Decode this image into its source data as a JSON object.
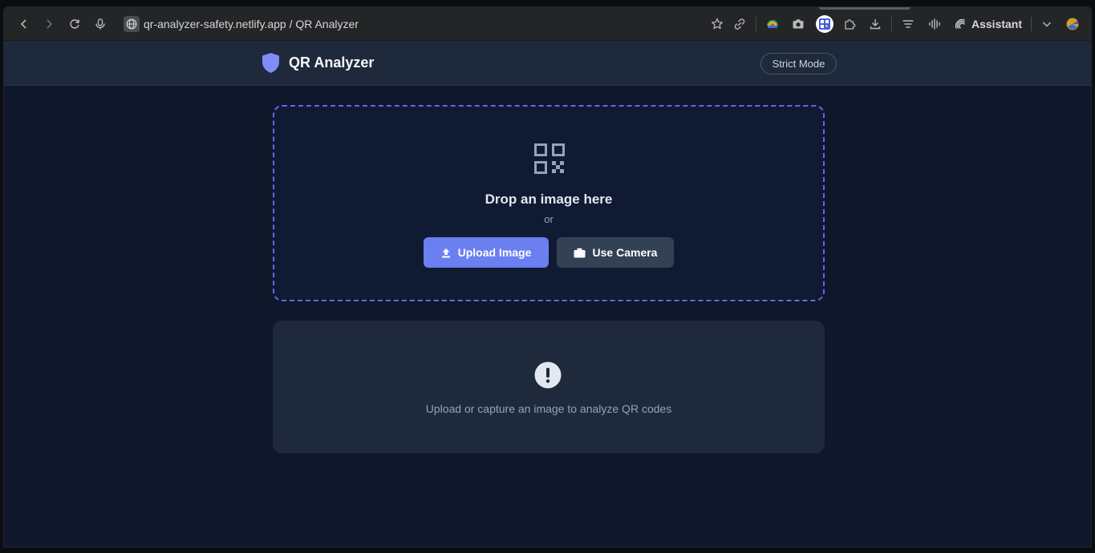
{
  "browser": {
    "url": "qr-analyzer-safety.netlify.app / QR Analyzer",
    "assistant_label": "Assistant"
  },
  "header": {
    "title": "QR Analyzer",
    "strict_mode_label": "Strict Mode"
  },
  "dropzone": {
    "title": "Drop an image here",
    "or_text": "or",
    "upload_label": "Upload Image",
    "camera_label": "Use Camera"
  },
  "result": {
    "message": "Upload or capture an image to analyze QR codes"
  },
  "colors": {
    "accent": "#6b7ff0",
    "page_bg": "#0f172a",
    "card_bg": "#1e293b",
    "dropzone_border": "#6366f1"
  }
}
